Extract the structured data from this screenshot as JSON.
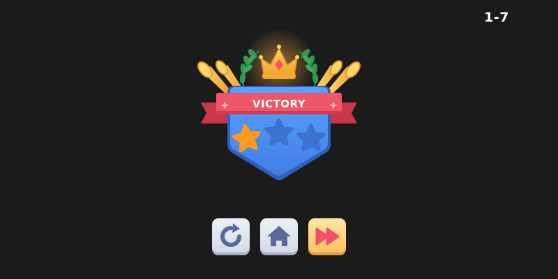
{
  "level": "1-7",
  "banner": {
    "title": "VICTORY"
  },
  "stars": {
    "earned": 1,
    "total": 3
  },
  "icons": {
    "replay": "replay-icon",
    "home": "home-icon",
    "next": "fast-forward-icon",
    "crown": "crown-icon",
    "laurel": "laurel-icon",
    "trumpet": "trumpet-icon"
  },
  "colors": {
    "background": "#1b1b1b",
    "shield": "#4a8ff0",
    "ribbon": "#f0566a",
    "crown": "#f6b533",
    "star_earned": "#ff9a1e",
    "star_empty": "#3d72cf",
    "next_button": "#ffc05a",
    "icon_ink": "#5a6a98",
    "next_icon": "#f2506a"
  }
}
